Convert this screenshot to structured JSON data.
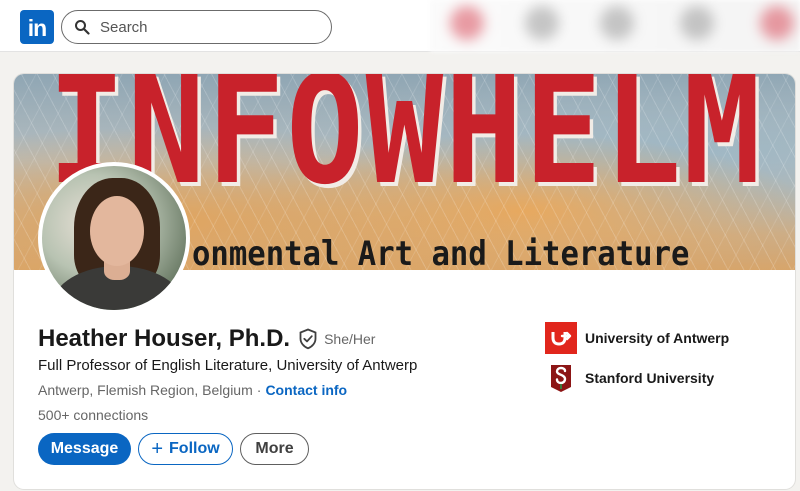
{
  "nav": {
    "logo_text": "in",
    "search_placeholder": "Search"
  },
  "banner": {
    "title": "INFOWHELM",
    "subtitle": "onmental Art and Literature"
  },
  "profile": {
    "name": "Heather Houser, Ph.D.",
    "pronouns": "She/Her",
    "headline": "Full Professor of English Literature, University of Antwerp",
    "location": "Antwerp, Flemish Region, Belgium",
    "location_separator": "·",
    "contact_info": "Contact info",
    "connections": "500+ connections"
  },
  "actions": {
    "message": "Message",
    "follow_plus": "+",
    "follow": "Follow",
    "more": "More"
  },
  "organizations": [
    {
      "name": "University of Antwerp",
      "logo": "university-of-antwerp-logo"
    },
    {
      "name": "Stanford University",
      "logo": "stanford-logo"
    }
  ],
  "colors": {
    "brand": "#0a66c2",
    "banner_red": "#c8222b",
    "antwerp_red": "#e1261c",
    "stanford_red": "#8c1515"
  }
}
